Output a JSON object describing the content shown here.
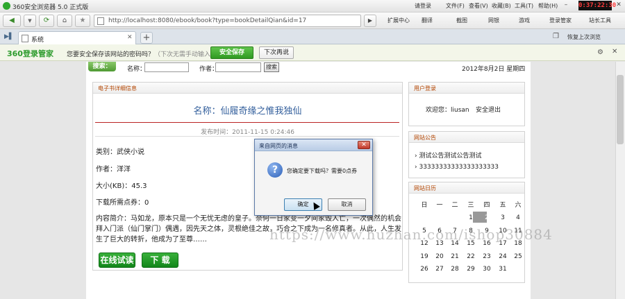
{
  "window": {
    "app_title": "360安全浏览器 5.0 正式版",
    "menu": [
      "请登录",
      "文件(F)",
      "查看(V)",
      "收藏(B)",
      "工具(T)",
      "帮助(H)"
    ],
    "clock": "0:37:22:30"
  },
  "nav": {
    "url": "http://localhost:8080/ebook/book?type=bookDetailQian&id=17",
    "tools": [
      "扩展中心",
      "翻译",
      "截图",
      "网银",
      "游戏",
      "登录管家",
      "站长工具"
    ]
  },
  "tabs": {
    "active_title": "系统",
    "restore_label": "恢复上次浏览"
  },
  "password_bar": {
    "brand": "360登录管家",
    "question": "您要安全保存该网站的密码吗？",
    "hint": "（下次无需手动输入）",
    "save_label": "安全保存",
    "later_label": "下次再说"
  },
  "search": {
    "tag": "搜索：",
    "name_label": "名称：",
    "author_label": "作者：",
    "button": "搜索",
    "date": "2012年8月2日 星期四"
  },
  "book": {
    "panel_title": "电子书详细信息",
    "title": "名称：仙履奇缘之惟我独仙",
    "publish_time": "发布时间：2011-11-15 0:24:46",
    "category": "类别：武侠小说",
    "author": "作者：洋洋",
    "size": "大小(KB)：45.3",
    "points": "下载所需点券：0",
    "description": "内容简介：马如龙，原本只是一个无忧无虑的皇子。奈何一日家变一夕间家毁人亡，一次偶然的机会拜入门派（仙门掌门）偶遇，因先天之体，灵根绝佳之故，巧合之下成为一名修真者。从此，人生发生了巨大的转折，他成为了至尊……",
    "read_btn": "在线试读",
    "download_btn": "下 载"
  },
  "user": {
    "panel_title": "用户登录",
    "welcome": "欢迎您：liusan",
    "logout": "安全退出"
  },
  "notices": {
    "panel_title": "网站公告",
    "items": [
      "测试公告测试公告测试",
      "33333333333333333333"
    ]
  },
  "calendar": {
    "panel_title": "网站日历",
    "weekdays": [
      "日",
      "一",
      "二",
      "三",
      "四",
      "五",
      "六"
    ],
    "weeks": [
      [
        "",
        "",
        "",
        "1",
        "2",
        "3",
        "4"
      ],
      [
        "5",
        "6",
        "7",
        "8",
        "9",
        "10",
        "11"
      ],
      [
        "12",
        "13",
        "14",
        "15",
        "16",
        "17",
        "18"
      ],
      [
        "19",
        "20",
        "21",
        "22",
        "23",
        "24",
        "25"
      ],
      [
        "26",
        "27",
        "28",
        "29",
        "30",
        "31",
        ""
      ]
    ],
    "today": "2"
  },
  "dialog": {
    "title": "来自网页的消息",
    "message": "您确定要下载吗？需要0点券",
    "ok": "确定",
    "cancel": "取消"
  },
  "watermark": "https://www.huzhan.com/ishop30884"
}
